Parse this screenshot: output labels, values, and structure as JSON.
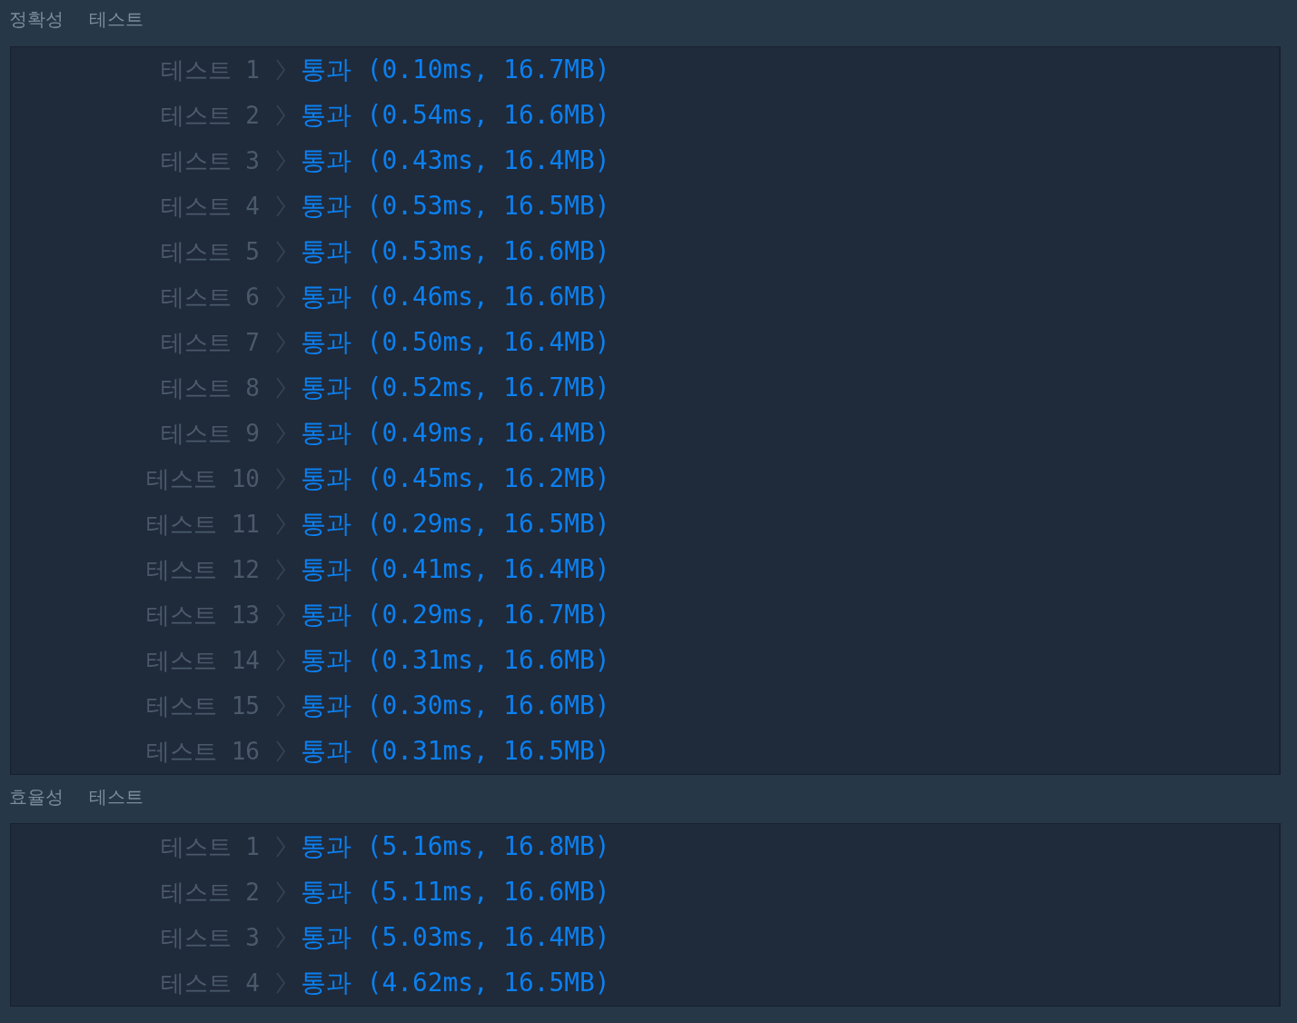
{
  "sections": [
    {
      "title": "정확성 테스트",
      "results": [
        {
          "label": "테스트 1",
          "result": "통과 (0.10ms, 16.7MB)"
        },
        {
          "label": "테스트 2",
          "result": "통과 (0.54ms, 16.6MB)"
        },
        {
          "label": "테스트 3",
          "result": "통과 (0.43ms, 16.4MB)"
        },
        {
          "label": "테스트 4",
          "result": "통과 (0.53ms, 16.5MB)"
        },
        {
          "label": "테스트 5",
          "result": "통과 (0.53ms, 16.6MB)"
        },
        {
          "label": "테스트 6",
          "result": "통과 (0.46ms, 16.6MB)"
        },
        {
          "label": "테스트 7",
          "result": "통과 (0.50ms, 16.4MB)"
        },
        {
          "label": "테스트 8",
          "result": "통과 (0.52ms, 16.7MB)"
        },
        {
          "label": "테스트 9",
          "result": "통과 (0.49ms, 16.4MB)"
        },
        {
          "label": "테스트 10",
          "result": "통과 (0.45ms, 16.2MB)"
        },
        {
          "label": "테스트 11",
          "result": "통과 (0.29ms, 16.5MB)"
        },
        {
          "label": "테스트 12",
          "result": "통과 (0.41ms, 16.4MB)"
        },
        {
          "label": "테스트 13",
          "result": "통과 (0.29ms, 16.7MB)"
        },
        {
          "label": "테스트 14",
          "result": "통과 (0.31ms, 16.6MB)"
        },
        {
          "label": "테스트 15",
          "result": "통과 (0.30ms, 16.6MB)"
        },
        {
          "label": "테스트 16",
          "result": "통과 (0.31ms, 16.5MB)"
        }
      ]
    },
    {
      "title": "효율성 테스트",
      "results": [
        {
          "label": "테스트 1",
          "result": "통과 (5.16ms, 16.8MB)"
        },
        {
          "label": "테스트 2",
          "result": "통과 (5.11ms, 16.6MB)"
        },
        {
          "label": "테스트 3",
          "result": "통과 (5.03ms, 16.4MB)"
        },
        {
          "label": "테스트 4",
          "result": "통과 (4.62ms, 16.5MB)"
        }
      ]
    }
  ]
}
